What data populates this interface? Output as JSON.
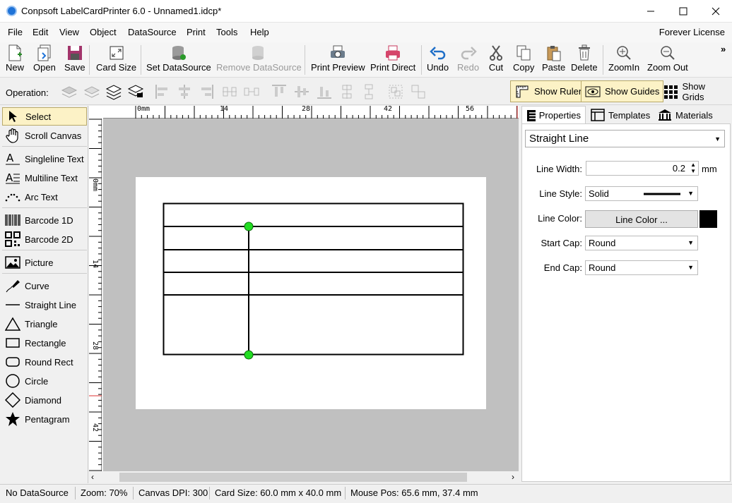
{
  "window": {
    "title": "Conpsoft LabelCardPrinter 6.0 - Unnamed1.idcp*"
  },
  "menu": {
    "items": [
      "File",
      "Edit",
      "View",
      "Object",
      "DataSource",
      "Print",
      "Tools",
      "Help"
    ],
    "license": "Forever License"
  },
  "toolbar": {
    "new": "New",
    "open": "Open",
    "save": "Save",
    "card_size": "Card Size",
    "set_datasource": "Set DataSource",
    "remove_datasource": "Remove DataSource",
    "print_preview": "Print Preview",
    "print_direct": "Print Direct",
    "undo": "Undo",
    "redo": "Redo",
    "cut": "Cut",
    "copy": "Copy",
    "paste": "Paste",
    "delete": "Delete",
    "zoom_in": "ZoomIn",
    "zoom_out": "Zoom Out",
    "more": "»"
  },
  "operation": {
    "label": "Operation:",
    "show_ruler": "Show Ruler",
    "show_guides": "Show Guides",
    "show_grids": "Show Grids"
  },
  "tools": {
    "select": "Select",
    "scroll_canvas": "Scroll Canvas",
    "singleline_text": "Singleline Text",
    "multiline_text": "Multiline Text",
    "arc_text": "Arc Text",
    "barcode_1d": "Barcode 1D",
    "barcode_2d": "Barcode 2D",
    "picture": "Picture",
    "curve": "Curve",
    "straight_line": "Straight Line",
    "triangle": "Triangle",
    "rectangle": "Rectangle",
    "round_rect": "Round Rect",
    "circle": "Circle",
    "diamond": "Diamond",
    "pentagram": "Pentagram"
  },
  "ruler": {
    "h": [
      "0mm",
      "14",
      "28",
      "42",
      "56"
    ],
    "v": [
      "0mm",
      "14",
      "28",
      "42"
    ]
  },
  "panel": {
    "tabs": {
      "properties": "Properties",
      "templates": "Templates",
      "materials": "Materials"
    },
    "object_type": "Straight Line",
    "line_width_label": "Line Width:",
    "line_width": "0.2",
    "line_width_unit": "mm",
    "line_style_label": "Line Style:",
    "line_style": "Solid",
    "line_color_label": "Line Color:",
    "line_color_button": "Line Color ...",
    "line_color": "#000000",
    "start_cap_label": "Start Cap:",
    "start_cap": "Round",
    "end_cap_label": "End Cap:",
    "end_cap": "Round"
  },
  "status": {
    "datasource": "No DataSource",
    "zoom": "Zoom: 70%",
    "dpi": "Canvas DPI: 300",
    "card_size": "Card Size: 60.0 mm x 40.0 mm",
    "mouse_pos": "Mouse Pos: 65.6 mm, 37.4 mm"
  },
  "colors": {
    "selection_handle": "#22dd22",
    "toggle_on": "#fcf2c6",
    "card": "#ffffff",
    "canvas": "#c0c0c0"
  }
}
